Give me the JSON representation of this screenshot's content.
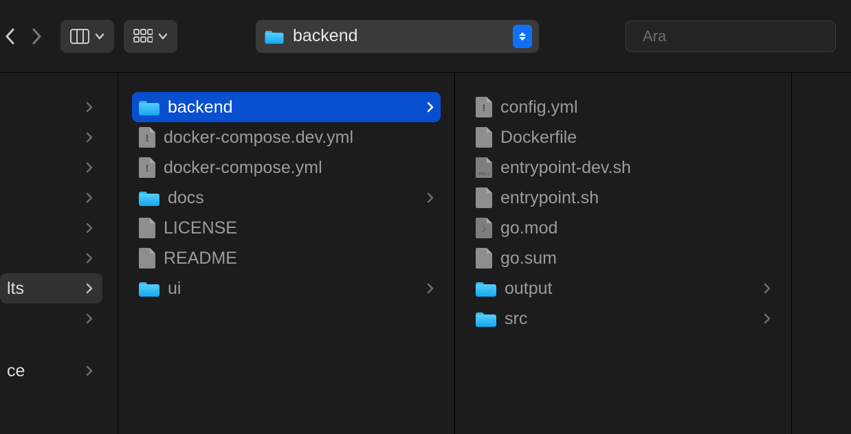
{
  "toolbar": {
    "current_path_label": "backend",
    "search_placeholder": "Ara"
  },
  "col0": {
    "items": [
      {
        "label": "",
        "chevron": true,
        "selected": false
      },
      {
        "label": "",
        "chevron": true,
        "selected": false
      },
      {
        "label": "",
        "chevron": true,
        "selected": false
      },
      {
        "label": "",
        "chevron": true,
        "selected": false
      },
      {
        "label": "",
        "chevron": true,
        "selected": false
      },
      {
        "label": "",
        "chevron": true,
        "selected": false
      },
      {
        "label": "lts",
        "chevron": true,
        "selected": true
      },
      {
        "label": "",
        "chevron": true,
        "selected": false
      },
      {
        "label": "ce",
        "chevron": true,
        "selected": false
      }
    ]
  },
  "col1": {
    "items": [
      {
        "icon": "folder",
        "label": "backend",
        "chevron": true,
        "selected": true
      },
      {
        "icon": "file-bang",
        "label": "docker-compose.dev.yml",
        "chevron": false,
        "selected": false
      },
      {
        "icon": "file-bang",
        "label": "docker-compose.yml",
        "chevron": false,
        "selected": false
      },
      {
        "icon": "folder",
        "label": "docs",
        "chevron": true,
        "selected": false
      },
      {
        "icon": "file",
        "label": "LICENSE",
        "chevron": false,
        "selected": false
      },
      {
        "icon": "file",
        "label": "README",
        "chevron": false,
        "selected": false
      },
      {
        "icon": "folder",
        "label": "ui",
        "chevron": true,
        "selected": false
      }
    ]
  },
  "col2": {
    "items": [
      {
        "icon": "file-bang",
        "label": "config.yml",
        "chevron": false,
        "selected": false
      },
      {
        "icon": "file",
        "label": "Dockerfile",
        "chevron": false,
        "selected": false
      },
      {
        "icon": "file-shell",
        "label": "entrypoint-dev.sh",
        "chevron": false,
        "selected": false
      },
      {
        "icon": "file",
        "label": "entrypoint.sh",
        "chevron": false,
        "selected": false
      },
      {
        "icon": "file-music",
        "label": "go.mod",
        "chevron": false,
        "selected": false
      },
      {
        "icon": "file",
        "label": "go.sum",
        "chevron": false,
        "selected": false
      },
      {
        "icon": "folder",
        "label": "output",
        "chevron": true,
        "selected": false
      },
      {
        "icon": "folder",
        "label": "src",
        "chevron": true,
        "selected": false
      }
    ]
  }
}
